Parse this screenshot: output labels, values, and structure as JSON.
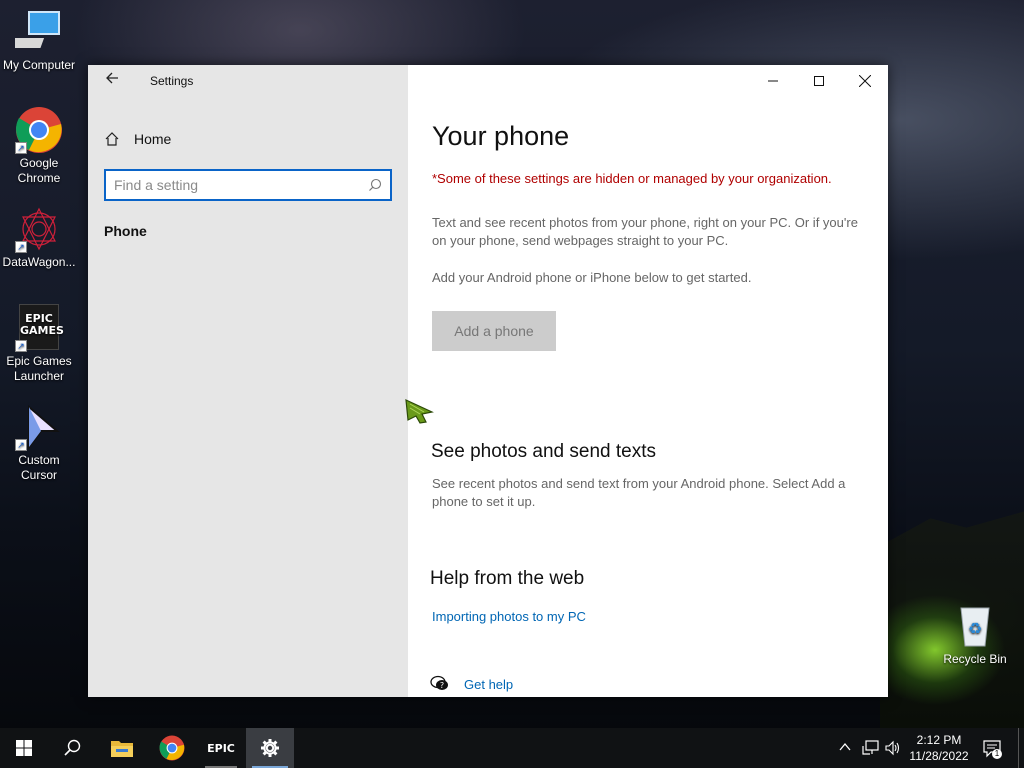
{
  "desktop": {
    "icons": [
      {
        "label": "My Computer"
      },
      {
        "label": "Google Chrome"
      },
      {
        "label": "DataWagon..."
      },
      {
        "label": "Epic Games Launcher",
        "badge_text": "EPIC GAMES"
      },
      {
        "label": "Custom Cursor"
      },
      {
        "label": "Recycle Bin"
      }
    ]
  },
  "window": {
    "title": "Settings",
    "sidebar": {
      "home_label": "Home",
      "search_placeholder": "Find a setting",
      "nav_items": [
        {
          "label": "Phone",
          "selected": true
        }
      ]
    },
    "main": {
      "title": "Your phone",
      "org_warning": "*Some of these settings are hidden or managed by your organization.",
      "description": "Text and see recent photos from your phone, right on your PC. Or if you're on your phone, send webpages straight to your PC.",
      "get_started": "Add your Android phone or iPhone below to get started.",
      "add_phone_button": "Add a phone",
      "photos_section": {
        "title": "See photos and send texts",
        "description": "See recent photos and send text from your Android phone. Select Add a phone to set it up."
      },
      "help_section": {
        "title": "Help from the web",
        "link": "Importing photos to my PC"
      },
      "get_help_label": "Get help"
    }
  },
  "taskbar": {
    "pinned": [
      {
        "name": "file-explorer"
      },
      {
        "name": "chrome"
      },
      {
        "name": "epic-games",
        "badge_text": "EPIC"
      },
      {
        "name": "settings",
        "active": true
      }
    ],
    "clock": {
      "time": "2:12 PM",
      "date": "11/28/2022"
    },
    "notification_count": "1"
  },
  "colors": {
    "accent": "#0a64c8",
    "warning": "#b00000",
    "link": "#0066b4",
    "sidebar_bg": "#e6e6e6",
    "taskbar_bg": "#101214"
  }
}
